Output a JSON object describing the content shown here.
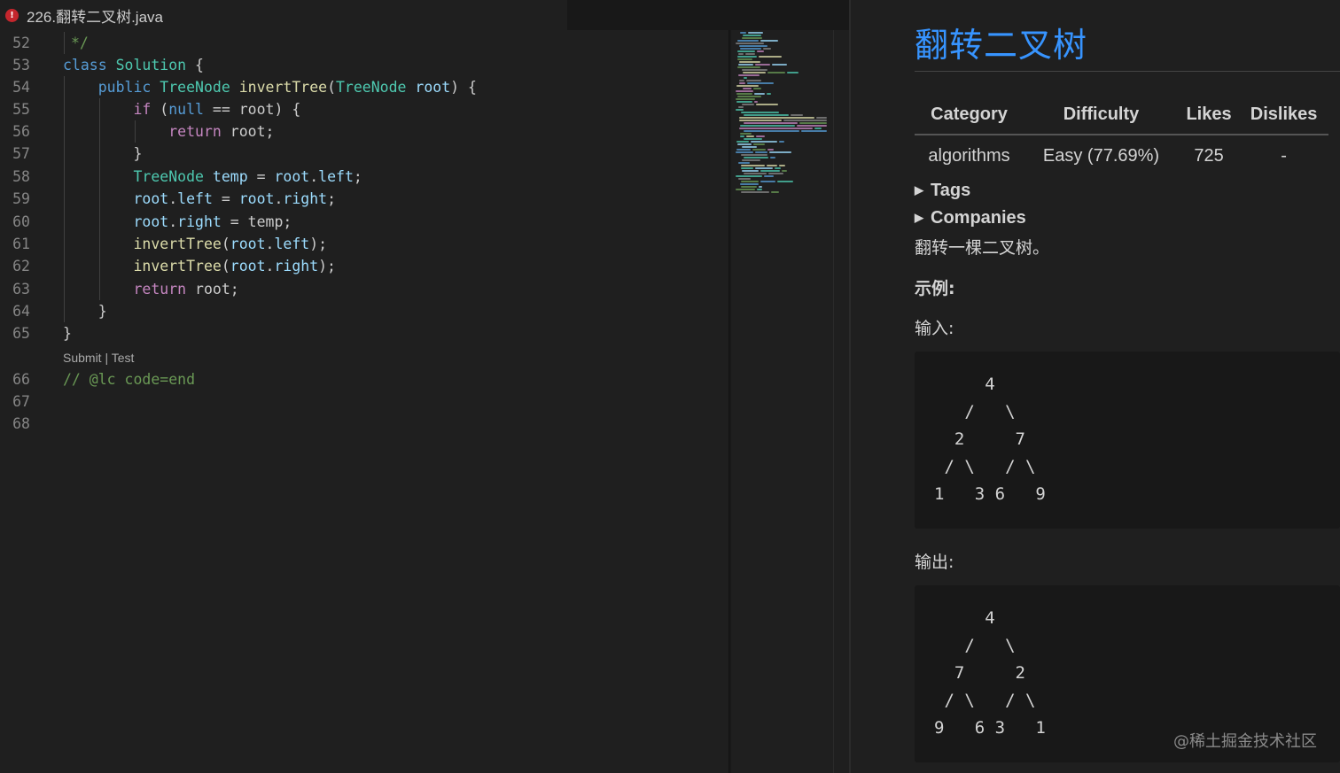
{
  "tab": {
    "title": "226.翻转二叉树.java",
    "error_badge": "!"
  },
  "editor": {
    "lines": [
      {
        "n": "52"
      },
      {
        "n": "53"
      },
      {
        "n": "54"
      },
      {
        "n": "55"
      },
      {
        "n": "56"
      },
      {
        "n": "57"
      },
      {
        "n": "58"
      },
      {
        "n": "59"
      },
      {
        "n": "60"
      },
      {
        "n": "61"
      },
      {
        "n": "62"
      },
      {
        "n": "63"
      },
      {
        "n": "64"
      },
      {
        "n": "65"
      },
      {
        "n": "66"
      },
      {
        "n": "67"
      },
      {
        "n": "68"
      }
    ],
    "code_lens": {
      "submit": "Submit",
      "sep": " | ",
      "test": "Test"
    },
    "code": {
      "l52": "*/",
      "l53_kw": "class",
      "l53_cls": "Solution",
      "l53_p": " {",
      "l54_kw": "public",
      "l54_type": "TreeNode",
      "l54_fn": "invertTree",
      "l54_ptype": "TreeNode",
      "l54_var": "root",
      "l55_ctl": "if",
      "l55_kw": "null",
      "l55_rest": " == root) {",
      "l56_ctl": "return",
      "l56_rest": " root;",
      "l57": "}",
      "l58_type": "TreeNode",
      "l58_var": "temp",
      "l58_a": "root",
      "l58_b": "left",
      "l59_a": "root",
      "l59_b": "left",
      "l59_c": "root",
      "l59_d": "right",
      "l60_a": "root",
      "l60_b": "right",
      "l60_rest": " = temp;",
      "l61_fn": "invertTree",
      "l61_a": "root",
      "l61_b": "left",
      "l62_fn": "invertTree",
      "l62_a": "root",
      "l62_b": "right",
      "l63_ctl": "return",
      "l63_rest": " root;",
      "l64": "}",
      "l65": "}",
      "l66": "// @lc code=end"
    }
  },
  "preview": {
    "title": "翻转二叉树",
    "table": {
      "headers": [
        "Category",
        "Difficulty",
        "Likes",
        "Dislikes"
      ],
      "row": [
        "algorithms",
        "Easy (77.69%)",
        "725",
        "-"
      ]
    },
    "tags_label": "Tags",
    "companies_label": "Companies",
    "description": "翻转一棵二叉树。",
    "example_label": "示例:",
    "input_label": "输入:",
    "input_tree": "     4\n   /   \\\n  2     7\n / \\   / \\\n1   3 6   9",
    "output_label": "输出:",
    "output_tree": "     4\n   /   \\\n  7     2\n / \\   / \\\n9   6 3   1"
  },
  "watermark": "@稀土掘金技术社区"
}
